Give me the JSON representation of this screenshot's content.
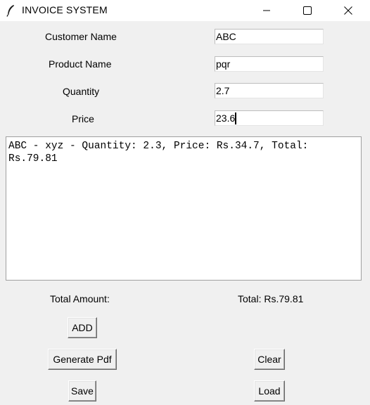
{
  "window": {
    "title": "INVOICE SYSTEM",
    "icons": {
      "app": "feather-icon",
      "minimize": "minimize-icon",
      "maximize": "maximize-icon",
      "close": "close-icon"
    }
  },
  "form": {
    "customer_label": "Customer Name",
    "customer_value": "ABC",
    "product_label": "Product Name",
    "product_value": "pqr",
    "quantity_label": "Quantity",
    "quantity_value": "2.7",
    "price_label": "Price",
    "price_value": "23.6"
  },
  "invoice_text": "ABC - xyz - Quantity: 2.3, Price: Rs.34.7, Total: Rs.79.81",
  "totals": {
    "label": "Total Amount:",
    "value": "Total: Rs.79.81"
  },
  "buttons": {
    "add": "ADD",
    "generate_pdf": "Generate Pdf",
    "clear": "Clear",
    "save": "Save",
    "load": "Load"
  }
}
